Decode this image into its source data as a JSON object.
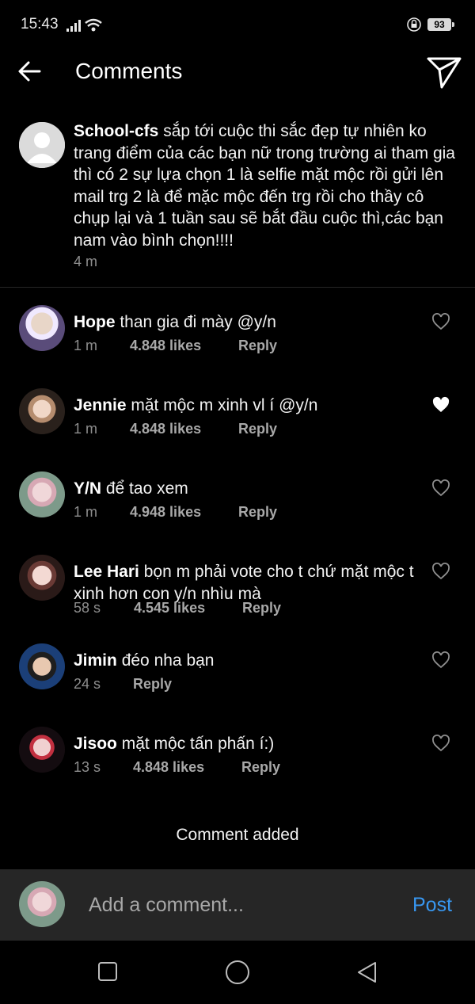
{
  "status_bar": {
    "time": "15:43",
    "battery": "93"
  },
  "header": {
    "title": "Comments"
  },
  "post": {
    "username": "School-cfs",
    "text": "sắp tới cuộc thi sắc đẹp tự nhiên ko trang điểm của các bạn nữ trong trường ai tham gia thì có 2 sự lựa chọn 1 là selfie mặt mộc rồi gửi lên mail trg 2 là để mặc mộc đến trg rồi cho thầy cô chụp lại và 1 tuần sau sẽ bắt đầu cuộc thì,các bạn nam vào bình chọn!!!!",
    "time": "4 m"
  },
  "comments": [
    {
      "username": "Hope",
      "text": "than gia đi mày @y/n",
      "time": "1 m",
      "likes": "4.848 likes",
      "reply": "Reply",
      "liked": false
    },
    {
      "username": "Jennie",
      "text": "mặt mộc m xinh vl í @y/n",
      "time": "1 m",
      "likes": "4.848 likes",
      "reply": "Reply",
      "liked": true
    },
    {
      "username": "Y/N",
      "text": "để tao xem",
      "time": "1 m",
      "likes": "4.948 likes",
      "reply": "Reply",
      "liked": false
    },
    {
      "username": "Lee Hari",
      "text": "bọn m phải vote cho t chứ mặt mộc t xinh hơn con y/n nhìu mà",
      "time": "58 s",
      "likes": "4.545 likes",
      "reply": "Reply",
      "liked": false
    },
    {
      "username": "Jimin",
      "text": "đéo nha bạn",
      "time": "24 s",
      "likes": "",
      "reply": "Reply",
      "liked": false
    },
    {
      "username": "Jisoo",
      "text": "mặt mộc tấn phấn í:)",
      "time": "13 s",
      "likes": "4.848 likes",
      "reply": "Reply",
      "liked": false
    }
  ],
  "toast": "Comment added",
  "composer": {
    "placeholder": "Add a comment...",
    "post_label": "Post"
  },
  "icons": {
    "back": "arrow-left-icon",
    "send": "paper-plane-icon",
    "heart": "heart-icon",
    "nav": [
      "square-icon",
      "circle-icon",
      "triangle-back-icon"
    ]
  },
  "colors": {
    "background": "#000000",
    "link": "#3897f0",
    "muted": "#8e8e8e",
    "composer_bg": "#262626"
  }
}
